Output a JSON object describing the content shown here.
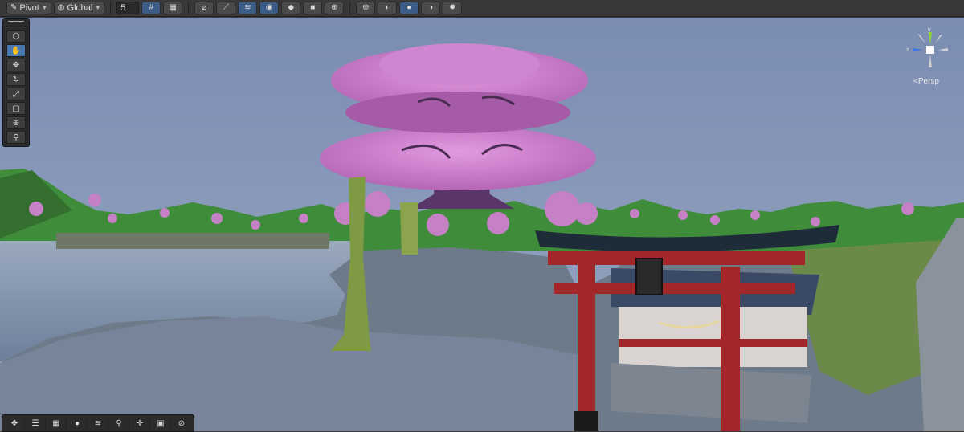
{
  "toolbar": {
    "pivot_label": "Pivot",
    "global_label": "Global",
    "grid_value": "5"
  },
  "gizmo": {
    "z_label": "z",
    "y_label": "y",
    "persp_label": "<Persp"
  },
  "scene": {
    "sky_color": "#7f8fb3",
    "water_color": "#8a9bb4",
    "blossom_color": "#c97ac8",
    "torii_color": "#a3262a",
    "hill_color": "#3d8a3a"
  },
  "icons": {
    "tools": [
      "hand-icon",
      "move-icon",
      "rotate-icon",
      "scale-icon",
      "rect-icon",
      "transform-icon",
      "custom-tool-icon"
    ],
    "overlays": [
      "move-icon",
      "align-icon",
      "grid-snap-icon",
      "sphere-icon",
      "layers-icon",
      "search-icon",
      "pivot-icon",
      "camera-icon",
      "compass-icon"
    ]
  }
}
